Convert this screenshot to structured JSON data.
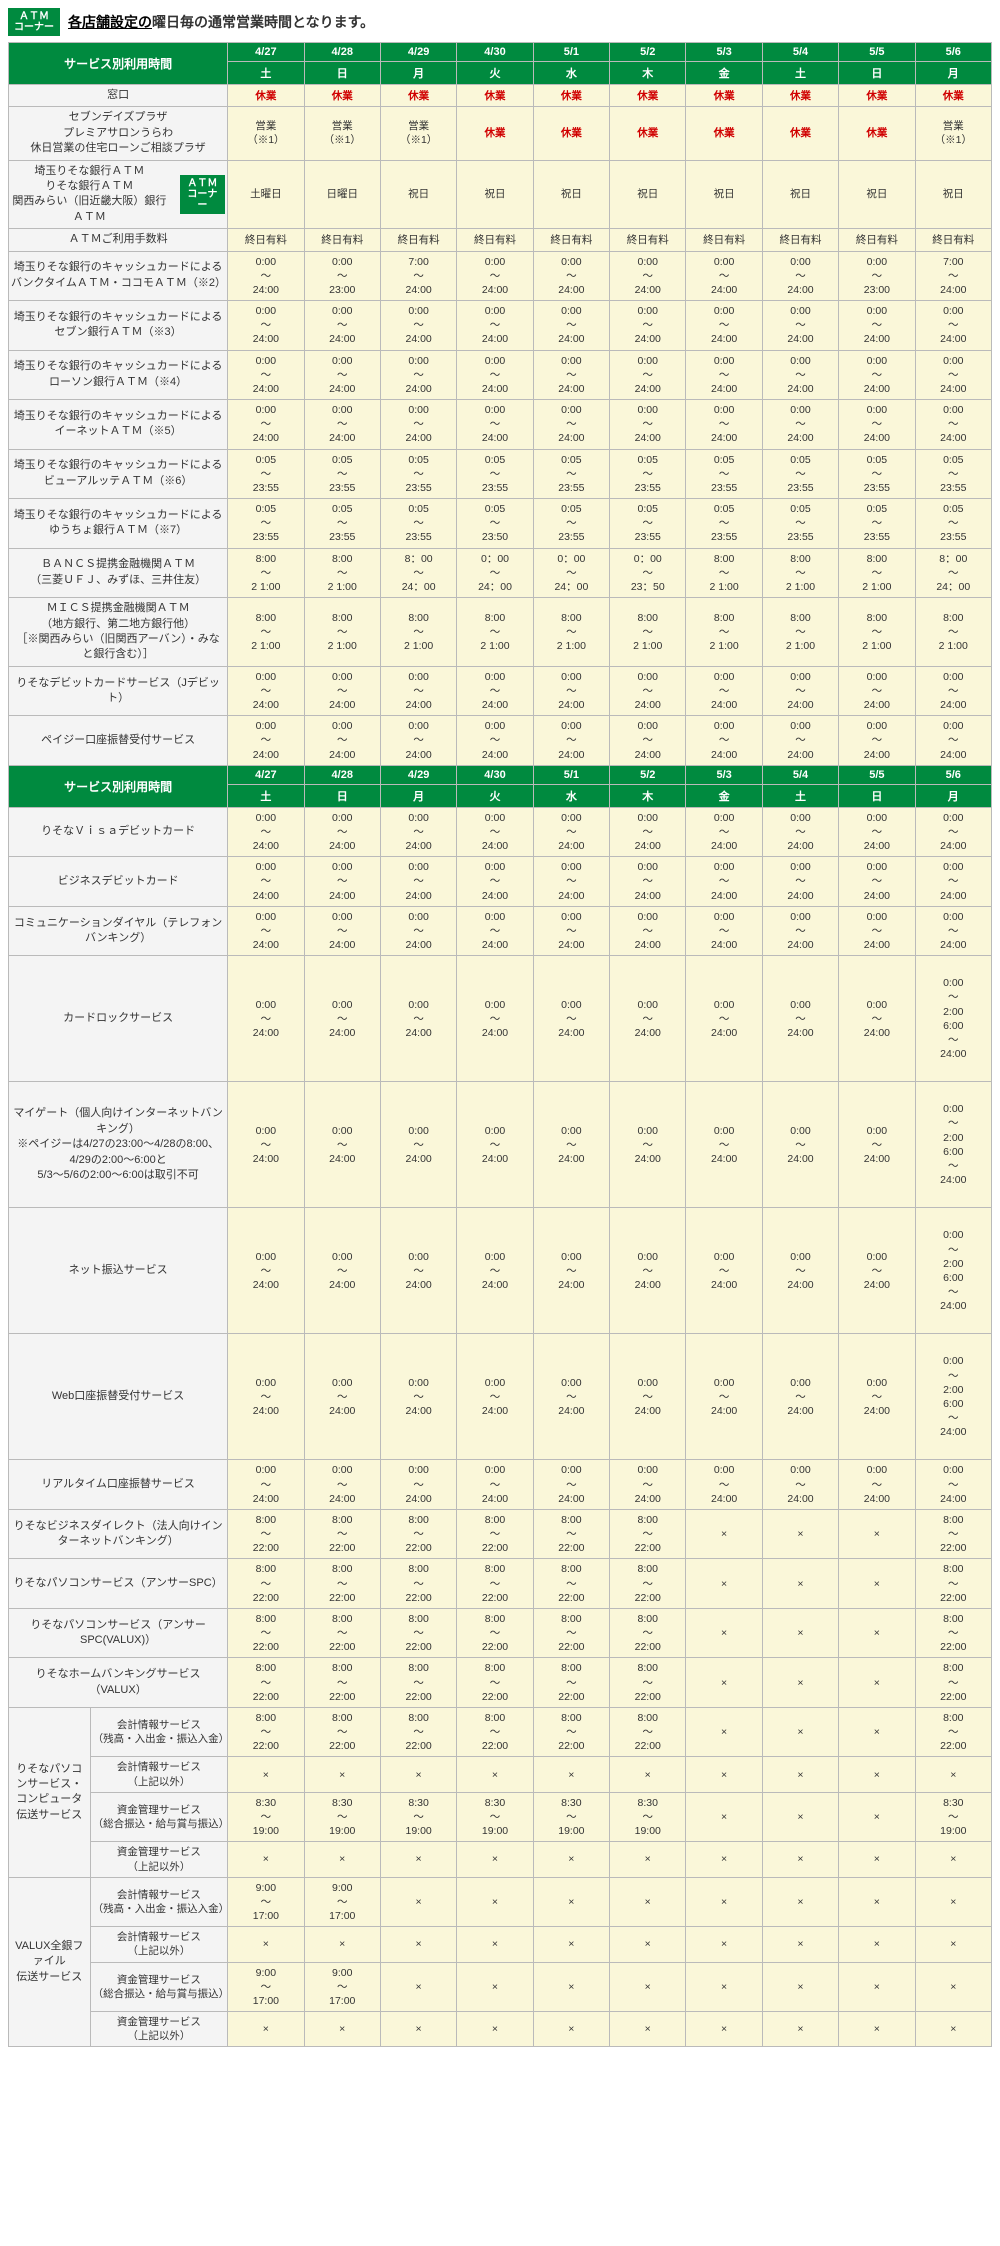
{
  "top": {
    "badge1": "ＡＴＭ",
    "badge2": "コーナー",
    "link": "各店舗設定の",
    "rest": "曜日毎の通常営業時間となります。"
  },
  "dates": [
    "4/27",
    "4/28",
    "4/29",
    "4/30",
    "5/1",
    "5/2",
    "5/3",
    "5/4",
    "5/5",
    "5/6"
  ],
  "days": [
    "土",
    "日",
    "月",
    "火",
    "水",
    "木",
    "金",
    "土",
    "日",
    "月"
  ],
  "section1_title": "サービス別利用時間",
  "rows_s1": [
    {
      "label": "窓口",
      "cells": [
        "休業",
        "休業",
        "休業",
        "休業",
        "休業",
        "休業",
        "休業",
        "休業",
        "休業",
        "休業"
      ],
      "red": true
    },
    {
      "label": "セブンデイズプラザ\nプレミアサロンうらわ\n休日営業の住宅ローンご相談プラザ",
      "cells": [
        "営業\n（※1）",
        "営業\n（※1）",
        "営業\n（※1）",
        "休業",
        "休業",
        "休業",
        "休業",
        "休業",
        "休業",
        "営業\n（※1）"
      ],
      "redFrom": 3,
      "redTo": 8,
      "thickBelow": true
    },
    {
      "label": "埼玉りそな銀行ＡＴＭ\nりそな銀行ＡＴＭ\n関西みらい（旧近畿大阪）銀行ＡＴＭ",
      "badge": true,
      "cells": [
        "土曜日",
        "日曜日",
        "祝日",
        "祝日",
        "祝日",
        "祝日",
        "祝日",
        "祝日",
        "祝日",
        "祝日"
      ]
    },
    {
      "label": "ＡＴＭご利用手数料",
      "cells": [
        "終日有料",
        "終日有料",
        "終日有料",
        "終日有料",
        "終日有料",
        "終日有料",
        "終日有料",
        "終日有料",
        "終日有料",
        "終日有料"
      ],
      "thickBelow": true
    },
    {
      "label": "埼玉りそな銀行のキャッシュカードによる\nバンクタイムＡＴＭ・ココモＡＴＭ（※2）",
      "cells": [
        "0:00\n～\n24:00",
        "0:00\n～\n23:00",
        "7:00\n～\n24:00",
        "0:00\n～\n24:00",
        "0:00\n～\n24:00",
        "0:00\n～\n24:00",
        "0:00\n～\n24:00",
        "0:00\n～\n24:00",
        "0:00\n～\n23:00",
        "7:00\n～\n24:00"
      ]
    },
    {
      "label": "埼玉りそな銀行のキャッシュカードによる\nセブン銀行ＡＴＭ（※3）",
      "cells": [
        "0:00\n～\n24:00",
        "0:00\n～\n24:00",
        "0:00\n～\n24:00",
        "0:00\n～\n24:00",
        "0:00\n～\n24:00",
        "0:00\n～\n24:00",
        "0:00\n～\n24:00",
        "0:00\n～\n24:00",
        "0:00\n～\n24:00",
        "0:00\n～\n24:00"
      ]
    },
    {
      "label": "埼玉りそな銀行のキャッシュカードによる\nローソン銀行ＡＴＭ（※4）",
      "cells": [
        "0:00\n～\n24:00",
        "0:00\n～\n24:00",
        "0:00\n～\n24:00",
        "0:00\n～\n24:00",
        "0:00\n～\n24:00",
        "0:00\n～\n24:00",
        "0:00\n～\n24:00",
        "0:00\n～\n24:00",
        "0:00\n～\n24:00",
        "0:00\n～\n24:00"
      ]
    },
    {
      "label": "埼玉りそな銀行のキャッシュカードによる\nイーネットＡＴＭ（※5）",
      "cells": [
        "0:00\n～\n24:00",
        "0:00\n～\n24:00",
        "0:00\n～\n24:00",
        "0:00\n～\n24:00",
        "0:00\n～\n24:00",
        "0:00\n～\n24:00",
        "0:00\n～\n24:00",
        "0:00\n～\n24:00",
        "0:00\n～\n24:00",
        "0:00\n～\n24:00"
      ]
    },
    {
      "label": "埼玉りそな銀行のキャッシュカードによる\nビューアルッテＡＴＭ（※6）",
      "cells": [
        "0:05\n～\n23:55",
        "0:05\n～\n23:55",
        "0:05\n～\n23:55",
        "0:05\n～\n23:55",
        "0:05\n～\n23:55",
        "0:05\n～\n23:55",
        "0:05\n～\n23:55",
        "0:05\n～\n23:55",
        "0:05\n～\n23:55",
        "0:05\n～\n23:55"
      ]
    },
    {
      "label": "埼玉りそな銀行のキャッシュカードによる\nゆうちょ銀行ＡＴＭ（※7）",
      "cells": [
        "0:05\n～\n23:55",
        "0:05\n～\n23:55",
        "0:05\n～\n23:55",
        "0:05\n～\n23:50",
        "0:05\n～\n23:55",
        "0:05\n～\n23:55",
        "0:05\n～\n23:55",
        "0:05\n～\n23:55",
        "0:05\n～\n23:55",
        "0:05\n～\n23:55"
      ]
    },
    {
      "label": "ＢＡＮＣＳ提携金融機関ＡＴＭ\n（三菱ＵＦＪ、みずほ、三井住友）",
      "cells": [
        "8:00\n～\n2 1:00",
        "8:00\n～\n2 1:00",
        "8：00\n～\n24：00",
        "0：00\n～\n24：00",
        "0：00\n～\n24：00",
        "0：00\n～\n23：50",
        "8:00\n～\n2 1:00",
        "8:00\n～\n2 1:00",
        "8:00\n～\n2 1:00",
        "8：00\n～\n24：00"
      ]
    },
    {
      "label": "ＭＩＣＳ提携金融機関ＡＴＭ\n（地方銀行、第二地方銀行他）\n［※関西みらい（旧関西アーバン）・みなと銀行含む）］",
      "cells": [
        "8:00\n～\n2 1:00",
        "8:00\n～\n2 1:00",
        "8:00\n～\n2 1:00",
        "8:00\n～\n2 1:00",
        "8:00\n～\n2 1:00",
        "8:00\n～\n2 1:00",
        "8:00\n～\n2 1:00",
        "8:00\n～\n2 1:00",
        "8:00\n～\n2 1:00",
        "8:00\n～\n2 1:00"
      ]
    },
    {
      "label": "りそなデビットカードサービス（Jデビット）",
      "cells": [
        "0:00\n～\n24:00",
        "0:00\n～\n24:00",
        "0:00\n～\n24:00",
        "0:00\n～\n24:00",
        "0:00\n～\n24:00",
        "0:00\n～\n24:00",
        "0:00\n～\n24:00",
        "0:00\n～\n24:00",
        "0:00\n～\n24:00",
        "0:00\n～\n24:00"
      ]
    },
    {
      "label": "ペイジー口座振替受付サービス",
      "cells": [
        "0:00\n～\n24:00",
        "0:00\n～\n24:00",
        "0:00\n～\n24:00",
        "0:00\n～\n24:00",
        "0:00\n～\n24:00",
        "0:00\n～\n24:00",
        "0:00\n～\n24:00",
        "0:00\n～\n24:00",
        "0:00\n～\n24:00",
        "0:00\n～\n24:00"
      ]
    }
  ],
  "rows_s2": [
    {
      "label": "りそなＶｉｓａデビットカード",
      "cells": [
        "0:00\n～\n24:00",
        "0:00\n～\n24:00",
        "0:00\n～\n24:00",
        "0:00\n～\n24:00",
        "0:00\n～\n24:00",
        "0:00\n～\n24:00",
        "0:00\n～\n24:00",
        "0:00\n～\n24:00",
        "0:00\n～\n24:00",
        "0:00\n～\n24:00"
      ]
    },
    {
      "label": "ビジネスデビットカード",
      "cells": [
        "0:00\n～\n24:00",
        "0:00\n～\n24:00",
        "0:00\n～\n24:00",
        "0:00\n～\n24:00",
        "0:00\n～\n24:00",
        "0:00\n～\n24:00",
        "0:00\n～\n24:00",
        "0:00\n～\n24:00",
        "0:00\n～\n24:00",
        "0:00\n～\n24:00"
      ]
    },
    {
      "label": "コミュニケーションダイヤル（テレフォンバンキング）",
      "cells": [
        "0:00\n～\n24:00",
        "0:00\n～\n24:00",
        "0:00\n～\n24:00",
        "0:00\n～\n24:00",
        "0:00\n～\n24:00",
        "0:00\n～\n24:00",
        "0:00\n～\n24:00",
        "0:00\n～\n24:00",
        "0:00\n～\n24:00",
        "0:00\n～\n24:00"
      ]
    },
    {
      "label": "カードロックサービス",
      "tall": true,
      "cells": [
        "0:00\n～\n24:00",
        "0:00\n～\n24:00",
        "0:00\n～\n24:00",
        "0:00\n～\n24:00",
        "0:00\n～\n24:00",
        "0:00\n～\n24:00",
        "0:00\n～\n24:00",
        "0:00\n～\n24:00",
        "0:00\n～\n24:00",
        "0:00\n～\n2:00\n6:00\n～\n24:00"
      ]
    },
    {
      "label": "マイゲート（個人向けインターネットバンキング）\n※ペイジーは4/27の23:00～4/28の8:00、4/29の2:00～6:00と\n5/3～5/6の2:00～6:00は取引不可",
      "tall": true,
      "cells": [
        "0:00\n～\n24:00",
        "0:00\n～\n24:00",
        "0:00\n～\n24:00",
        "0:00\n～\n24:00",
        "0:00\n～\n24:00",
        "0:00\n～\n24:00",
        "0:00\n～\n24:00",
        "0:00\n～\n24:00",
        "0:00\n～\n24:00",
        "0:00\n～\n2:00\n6:00\n～\n24:00"
      ]
    },
    {
      "label": "ネット振込サービス",
      "tall": true,
      "cells": [
        "0:00\n～\n24:00",
        "0:00\n～\n24:00",
        "0:00\n～\n24:00",
        "0:00\n～\n24:00",
        "0:00\n～\n24:00",
        "0:00\n～\n24:00",
        "0:00\n～\n24:00",
        "0:00\n～\n24:00",
        "0:00\n～\n24:00",
        "0:00\n～\n2:00\n6:00\n～\n24:00"
      ]
    },
    {
      "label": "Web口座振替受付サービス",
      "tall": true,
      "cells": [
        "0:00\n～\n24:00",
        "0:00\n～\n24:00",
        "0:00\n～\n24:00",
        "0:00\n～\n24:00",
        "0:00\n～\n24:00",
        "0:00\n～\n24:00",
        "0:00\n～\n24:00",
        "0:00\n～\n24:00",
        "0:00\n～\n24:00",
        "0:00\n～\n2:00\n6:00\n～\n24:00"
      ]
    },
    {
      "label": "リアルタイム口座振替サービス",
      "cells": [
        "0:00\n～\n24:00",
        "0:00\n～\n24:00",
        "0:00\n～\n24:00",
        "0:00\n～\n24:00",
        "0:00\n～\n24:00",
        "0:00\n～\n24:00",
        "0:00\n～\n24:00",
        "0:00\n～\n24:00",
        "0:00\n～\n24:00",
        "0:00\n～\n24:00"
      ]
    },
    {
      "label": "りそなビジネスダイレクト（法人向けインターネットバンキング）",
      "cells": [
        "8:00\n～\n22:00",
        "8:00\n～\n22:00",
        "8:00\n～\n22:00",
        "8:00\n～\n22:00",
        "8:00\n～\n22:00",
        "8:00\n～\n22:00",
        "×",
        "×",
        "×",
        "8:00\n～\n22:00"
      ]
    },
    {
      "label": "りそなパソコンサービス（アンサーSPC）",
      "cells": [
        "8:00\n～\n22:00",
        "8:00\n～\n22:00",
        "8:00\n～\n22:00",
        "8:00\n～\n22:00",
        "8:00\n～\n22:00",
        "8:00\n～\n22:00",
        "×",
        "×",
        "×",
        "8:00\n～\n22:00"
      ]
    },
    {
      "label": "りそなパソコンサービス（アンサーSPC(VALUX)）",
      "cells": [
        "8:00\n～\n22:00",
        "8:00\n～\n22:00",
        "8:00\n～\n22:00",
        "8:00\n～\n22:00",
        "8:00\n～\n22:00",
        "8:00\n～\n22:00",
        "×",
        "×",
        "×",
        "8:00\n～\n22:00"
      ]
    },
    {
      "label": "りそなホームバンキングサービス（VALUX）",
      "cells": [
        "8:00\n～\n22:00",
        "8:00\n～\n22:00",
        "8:00\n～\n22:00",
        "8:00\n～\n22:00",
        "8:00\n～\n22:00",
        "8:00\n～\n22:00",
        "×",
        "×",
        "×",
        "8:00\n～\n22:00"
      ]
    }
  ],
  "group1": {
    "title": "りそなパソコンサービス・\nコンピュータ伝送サービス",
    "rows": [
      {
        "label": "会計情報サービス\n（残高・入出金・振込入金）",
        "cells": [
          "8:00\n～\n22:00",
          "8:00\n～\n22:00",
          "8:00\n～\n22:00",
          "8:00\n～\n22:00",
          "8:00\n～\n22:00",
          "8:00\n～\n22:00",
          "×",
          "×",
          "×",
          "8:00\n～\n22:00"
        ]
      },
      {
        "label": "会計情報サービス\n（上記以外）",
        "cells": [
          "×",
          "×",
          "×",
          "×",
          "×",
          "×",
          "×",
          "×",
          "×",
          "×"
        ]
      },
      {
        "label": "資金管理サービス\n（総合振込・給与賞与振込）",
        "cells": [
          "8:30\n～\n19:00",
          "8:30\n～\n19:00",
          "8:30\n～\n19:00",
          "8:30\n～\n19:00",
          "8:30\n～\n19:00",
          "8:30\n～\n19:00",
          "×",
          "×",
          "×",
          "8:30\n～\n19:00"
        ]
      },
      {
        "label": "資金管理サービス\n（上記以外）",
        "cells": [
          "×",
          "×",
          "×",
          "×",
          "×",
          "×",
          "×",
          "×",
          "×",
          "×"
        ]
      }
    ]
  },
  "group2": {
    "title": "VALUX全銀ファイル\n伝送サービス",
    "rows": [
      {
        "label": "会計情報サービス\n（残高・入出金・振込入金）",
        "cells": [
          "9:00\n～\n17:00",
          "9:00\n～\n17:00",
          "×",
          "×",
          "×",
          "×",
          "×",
          "×",
          "×",
          "×"
        ]
      },
      {
        "label": "会計情報サービス\n（上記以外）",
        "cells": [
          "×",
          "×",
          "×",
          "×",
          "×",
          "×",
          "×",
          "×",
          "×",
          "×"
        ]
      },
      {
        "label": "資金管理サービス\n（総合振込・給与賞与振込）",
        "cells": [
          "9:00\n～\n17:00",
          "9:00\n～\n17:00",
          "×",
          "×",
          "×",
          "×",
          "×",
          "×",
          "×",
          "×"
        ]
      },
      {
        "label": "資金管理サービス\n（上記以外）",
        "cells": [
          "×",
          "×",
          "×",
          "×",
          "×",
          "×",
          "×",
          "×",
          "×",
          "×"
        ]
      }
    ]
  }
}
